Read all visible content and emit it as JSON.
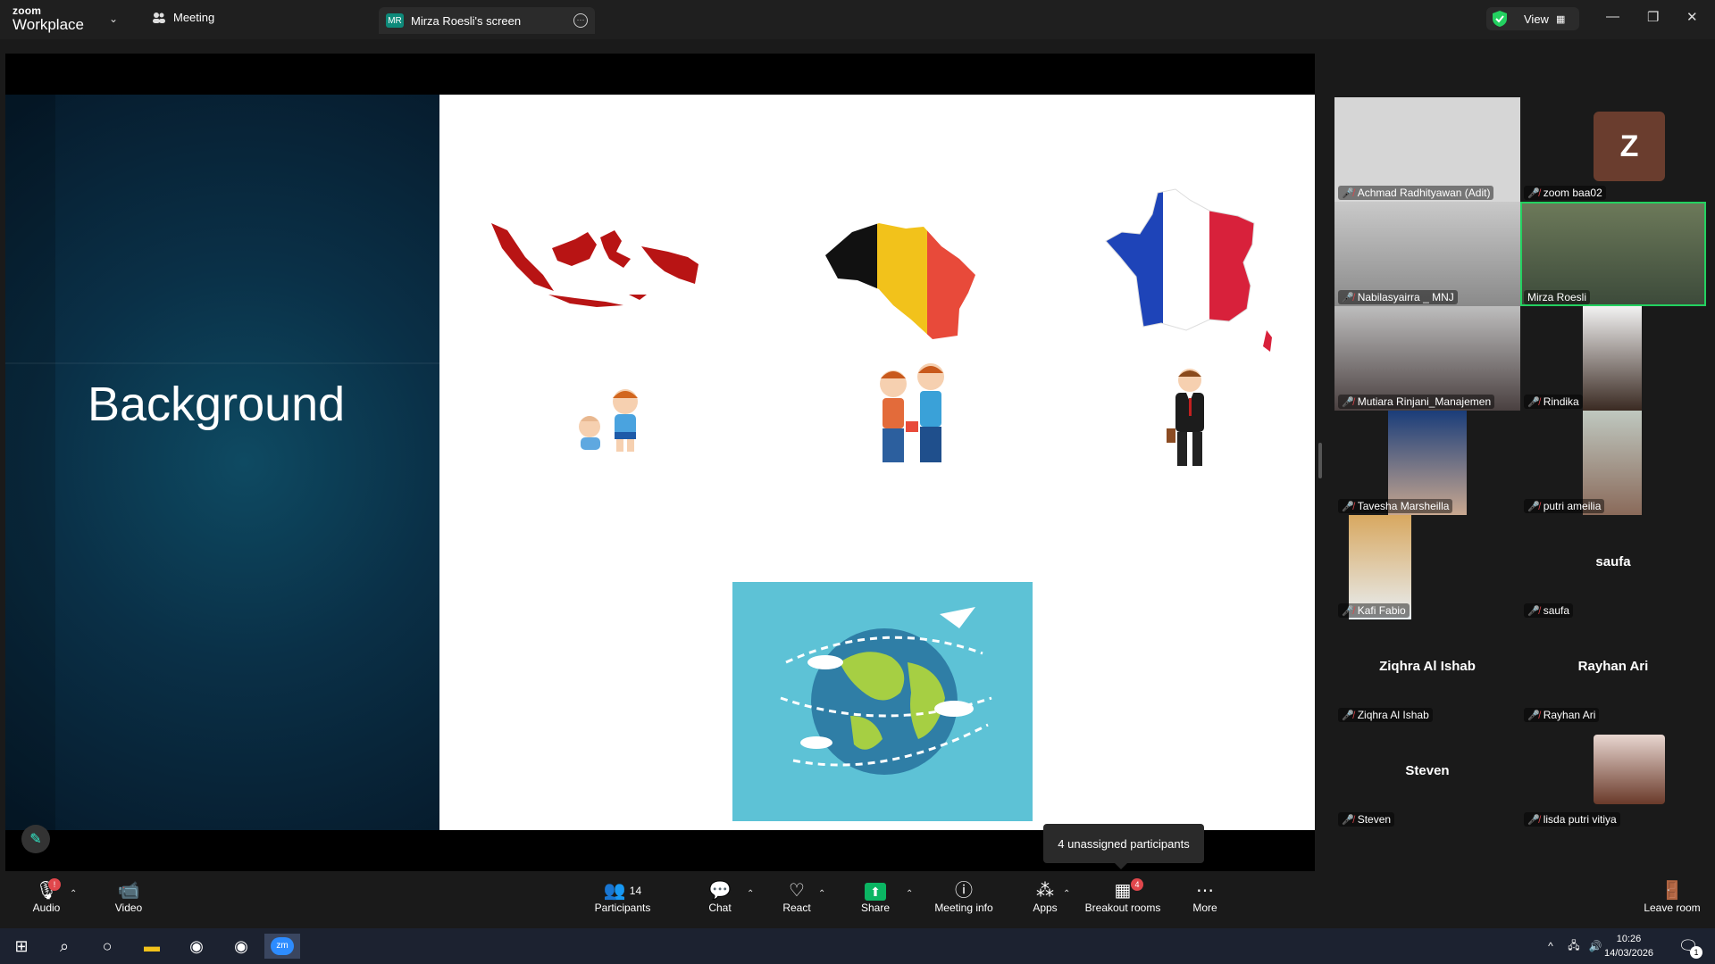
{
  "app": {
    "brand_top": "zoom",
    "brand_bottom": "Workplace"
  },
  "tabs": {
    "meeting": "Meeting",
    "screen": "Mirza Roesli's screen",
    "screen_badge": "MR",
    "view": "View"
  },
  "slide": {
    "title": "Background"
  },
  "participants": [
    {
      "name": "Achmad Radhityawan (Adit)",
      "muted": true,
      "video": true
    },
    {
      "name": "zoom baa02",
      "muted": true,
      "avatar_letter": "Z"
    },
    {
      "name": "Nabilasyairra _ MNJ",
      "muted": true,
      "video": true
    },
    {
      "name": "Mirza Roesli",
      "muted": false,
      "video": true,
      "active_speaker": true
    },
    {
      "name": "Mutiara Rinjani_Manajemen",
      "muted": true,
      "video": true
    },
    {
      "name": "Rindika",
      "muted": true,
      "video": true
    },
    {
      "name": "Tavesha Marsheilla",
      "muted": true,
      "video": true
    },
    {
      "name": "putri ameilia",
      "muted": true,
      "video": true
    },
    {
      "name": "Kafi Fabio",
      "muted": true,
      "video": true
    },
    {
      "name": "saufa",
      "muted": true,
      "display_name": "saufa"
    },
    {
      "name": "Ziqhra Al Ishab",
      "muted": true,
      "display_name": "Ziqhra Al Ishab"
    },
    {
      "name": "Rayhan Ari",
      "muted": true,
      "display_name": "Rayhan Ari"
    },
    {
      "name": "Steven",
      "muted": true,
      "display_name": "Steven"
    },
    {
      "name": "lisda putri vitiya",
      "muted": true,
      "video": true
    }
  ],
  "toolbar": {
    "audio": "Audio",
    "video": "Video",
    "participants": "Participants",
    "participants_count": "14",
    "chat": "Chat",
    "react": "React",
    "share": "Share",
    "meeting_info": "Meeting info",
    "apps": "Apps",
    "breakout": "Breakout rooms",
    "breakout_badge": "4",
    "more": "More",
    "leave": "Leave room"
  },
  "tooltip": "4 unassigned participants",
  "taskbar": {
    "time": "10:26",
    "date": "14/03/2026",
    "notification_count": "1"
  },
  "colors": {
    "accent_green": "#23d160",
    "mute_red": "#e0474c",
    "share_green": "#0bb563"
  }
}
